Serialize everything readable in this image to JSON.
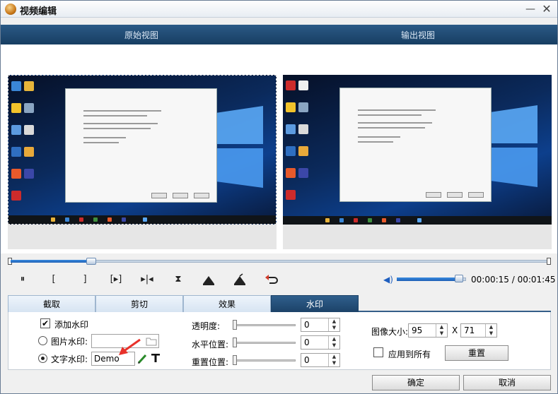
{
  "window": {
    "title": "视频编辑",
    "minimize": "—",
    "close": "✕"
  },
  "views": {
    "original_label": "原始视图",
    "output_label": "输出视图"
  },
  "playback": {
    "progress_fraction": 0.15,
    "volume_fraction": 0.95,
    "time_current": "00:00:15",
    "time_separator": " / ",
    "time_total": "00:01:45",
    "buttons": {
      "pause": "⏸",
      "mark_in": "[",
      "mark_out": "]",
      "next_frame": "[▸]",
      "play_to_end": "▸|◂",
      "split": "⧗"
    }
  },
  "tabs": [
    {
      "label": "截取",
      "active": false
    },
    {
      "label": "剪切",
      "active": false
    },
    {
      "label": "效果",
      "active": false
    },
    {
      "label": "水印",
      "active": true
    }
  ],
  "watermark": {
    "add_watermark_label": "添加水印",
    "add_watermark_checked": "✔",
    "image_watermark_label": "图片水印:",
    "text_watermark_label": "文字水印:",
    "text_value": "Demo",
    "opacity_label": "透明度:",
    "opacity_value": "0",
    "h_pos_label": "水平位置:",
    "h_pos_value": "0",
    "v_pos_label": "重置位置:",
    "v_pos_value": "0",
    "image_size_label": "图像大小:",
    "width_value": "95",
    "size_x": "X",
    "height_value": "71",
    "apply_all_label": "应用到所有",
    "reset_label": "重置"
  },
  "footer": {
    "ok_label": "确定",
    "cancel_label": "取消"
  },
  "colors": {
    "accent": "#1c4268",
    "header": "#173e62",
    "arrow": "#e8322b"
  }
}
